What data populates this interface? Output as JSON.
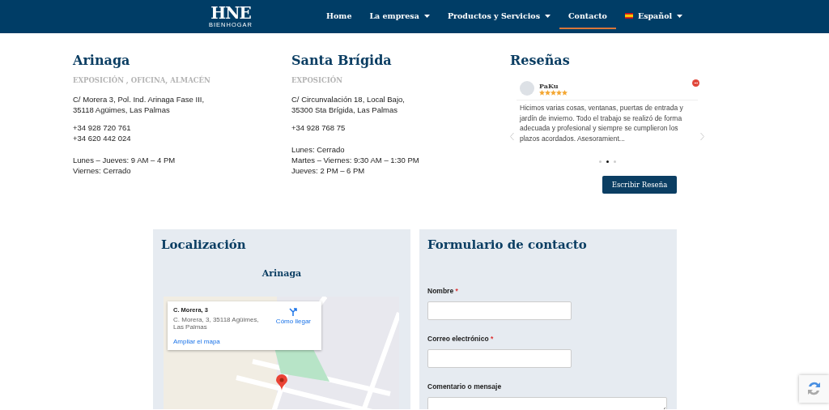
{
  "header": {
    "logo": {
      "title": "HNE",
      "subtitle": "BIENHOGAR"
    },
    "nav": [
      {
        "label": "Home",
        "dropdown": false,
        "selected": false,
        "flag": false
      },
      {
        "label": "La empresa",
        "dropdown": true,
        "selected": false,
        "flag": false
      },
      {
        "label": "Productos y Servicios",
        "dropdown": true,
        "selected": false,
        "flag": false
      },
      {
        "label": "Contacto",
        "dropdown": false,
        "selected": true,
        "flag": false
      },
      {
        "label": "Español",
        "dropdown": true,
        "selected": false,
        "flag": true
      }
    ]
  },
  "locations": [
    {
      "title": "Arinaga",
      "subtitle": "EXPOSICIÓN , OFICINA, ALMACÉN",
      "blocks": [
        [
          "C/ Morera 3, Pol. Ind. Arinaga Fase III,",
          "35118 Agüimes, Las Palmas"
        ],
        [
          "+34 928 720 761",
          "+34 620 442 024"
        ],
        [
          "Lunes – Jueves: 9 AM – 4 PM",
          "Viernes: Cerrado"
        ]
      ]
    },
    {
      "title": "Santa Brígida",
      "subtitle": "EXPOSICIÓN",
      "blocks": [
        [
          "C/ Circunvalación 18, Local Bajo,",
          "35300 Sta Brígida, Las Palmas"
        ],
        [
          "+34 928 768 75"
        ],
        [
          "Lunes: Cerrado",
          "Martes – Viernes: 9:30 AM – 1:30 PM",
          "Jueves: 2 PM – 6 PM"
        ]
      ]
    }
  ],
  "reviews": {
    "title": "Reseñas",
    "review": {
      "author": "PaKu",
      "stars": 5,
      "text": "Hicimos varias cosas, ventanas, puertas de entrada y jardín de invierno. Todo el trabajo se realizó de forma adecuada y profesional y siempre se cumplieron los plazos acordados. Asesoramient..."
    },
    "dots": [
      {
        "selected": false
      },
      {
        "selected": true
      },
      {
        "selected": false
      }
    ],
    "button": "Escribir Reseña"
  },
  "location_panel": {
    "title": "Localización",
    "subtitle": "Arinaga",
    "map_card": {
      "title": "C. Morera, 3",
      "address": "C. Morera, 3, 35118 Agüimes, Las Palmas",
      "directions": "Cómo llegar",
      "enlarge": "Ampliar el mapa"
    }
  },
  "contact_form": {
    "title": "Formulario de contacto",
    "fields": [
      {
        "label": "Nombre",
        "required_mark": "*",
        "kind": "input"
      },
      {
        "label": "Correo electrónico",
        "required_mark": "*",
        "kind": "input"
      },
      {
        "label": "Comentario o mensaje",
        "kind": "textarea"
      }
    ]
  }
}
